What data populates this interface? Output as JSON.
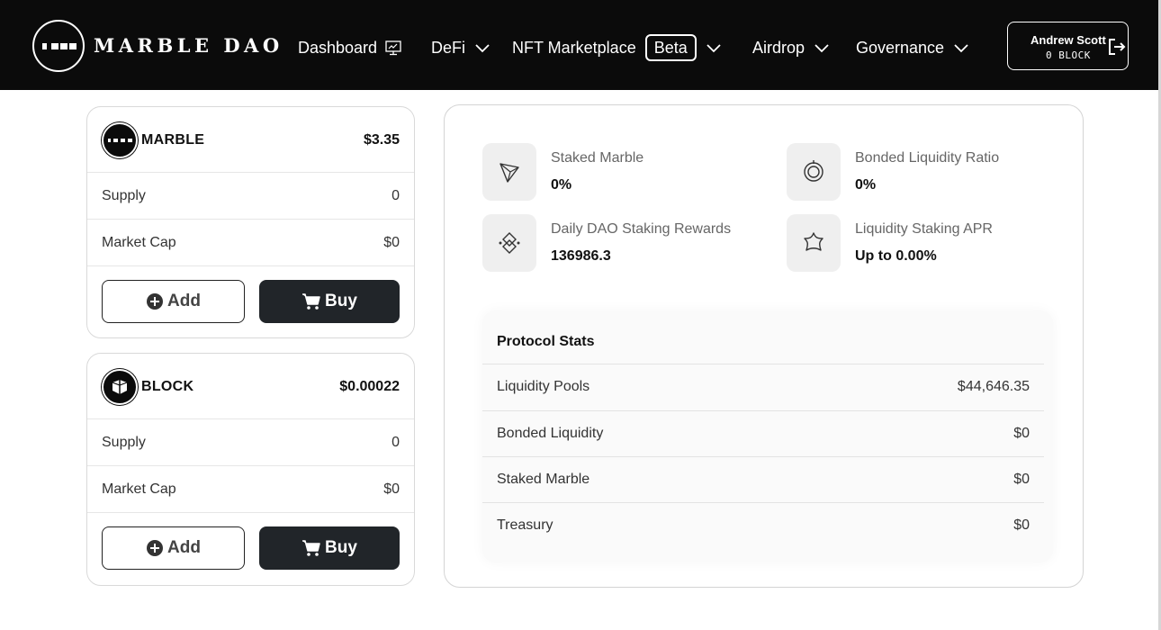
{
  "app": {
    "logo_text": "MARBLE DAO"
  },
  "nav": {
    "items": [
      {
        "label": "Dashboard",
        "icon": "monitor-icon"
      },
      {
        "label": "DeFi",
        "icon": "chevron-down-icon"
      },
      {
        "label": "NFT Marketplace",
        "badge": "Beta",
        "icon": "chevron-down-icon"
      },
      {
        "label": "Airdrop",
        "icon": "chevron-down-icon"
      },
      {
        "label": "Governance",
        "icon": "chevron-down-icon"
      }
    ]
  },
  "user": {
    "name": "Andrew Scott",
    "balance": "0 BLOCK",
    "logout_icon": "logout-icon"
  },
  "tokens": [
    {
      "name": "MARBLE",
      "price": "$3.35",
      "supply_label": "Supply",
      "supply": "0",
      "market_cap_label": "Market Cap",
      "market_cap": "$0",
      "add_label": "Add",
      "buy_label": "Buy"
    },
    {
      "name": "BLOCK",
      "price": "$0.00022",
      "supply_label": "Supply",
      "supply": "0",
      "market_cap_label": "Market Cap",
      "market_cap": "$0",
      "add_label": "Add",
      "buy_label": "Buy"
    }
  ],
  "stats": [
    {
      "label": "Staked Marble",
      "value": "0%",
      "icon": "tron-icon"
    },
    {
      "label": "Daily DAO Staking Rewards",
      "value": "136986.3",
      "icon": "diamond-link-icon"
    },
    {
      "label": "Bonded Liquidity Ratio",
      "value": "0%",
      "icon": "rings-icon"
    },
    {
      "label": "Liquidity Staking APR",
      "value": "Up to 0.00%",
      "icon": "star-badge-icon"
    }
  ],
  "protocol": {
    "title": "Protocol Stats",
    "rows": [
      {
        "label": "Liquidity Pools",
        "value": "$44,646.35"
      },
      {
        "label": "Bonded Liquidity",
        "value": "$0"
      },
      {
        "label": "Staked Marble",
        "value": "$0"
      },
      {
        "label": "Treasury",
        "value": "$0"
      }
    ]
  },
  "colors": {
    "header_bg": "#0b0b0b",
    "buy_button_bg": "#212529",
    "panel_border": "#d4d4d4"
  }
}
